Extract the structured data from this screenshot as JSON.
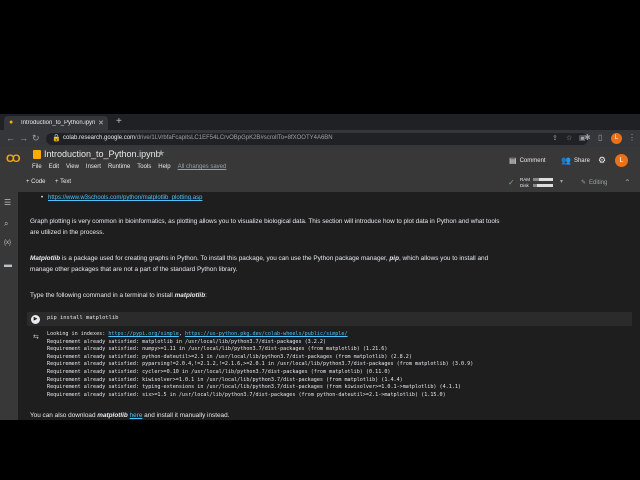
{
  "browser": {
    "tab_title": "Introduction_to_Python.ipynb",
    "new_tab": "+",
    "url_host": "colab.research.google.com",
    "url_path": "/drive/1LVrbfaFcapitsLC1EF54LCrvOBpGpK2B#scrollTo=8fXOOTY4A6BN",
    "profile_initial": "L"
  },
  "colab": {
    "logo": "CO",
    "notebook_title": "Introduction_to_Python.ipynb",
    "menu": [
      "File",
      "Edit",
      "View",
      "Insert",
      "Runtime",
      "Tools",
      "Help"
    ],
    "save_status": "All changes saved",
    "comment_label": "Comment",
    "share_label": "Share",
    "profile_initial": "L"
  },
  "toolbar": {
    "add_code": "+ Code",
    "add_text": "+ Text",
    "ram_label": "RAM",
    "disk_label": "Disk",
    "ram_usage": 0.28,
    "disk_usage": 0.22,
    "mode_label": "Editing"
  },
  "content": {
    "link1": "https://www.w3schools.com/python/matplotlib_plotting.asp",
    "para1": "Graph plotting is very common in bioinformatics, as plotting allows you to visualize biological data. This section will introduce how to plot data in Python and what tools are utilized in the process.",
    "para2_pkg": "Matplotlib",
    "para2_a": " is a package used for creating graphs in Python. To install this package, you can use the Python package manager, ",
    "para2_pip": "pip",
    "para2_b": ", which allows you to install and manage other packages that are not a part of the standard Python library.",
    "para3_a": "Type the following command in a terminal to install ",
    "para3_pkg": "matplotlib",
    "para3_b": ":",
    "code": "pip install matplotlib",
    "output_head": "Looking in indexes: ",
    "output_link1": "https://pypi.org/simple",
    "output_sep": ", ",
    "output_link2": "https://us-python.pkg.dev/colab-wheels/public/simple/",
    "output_lines": [
      "Requirement already satisfied: matplotlib in /usr/local/lib/python3.7/dist-packages (3.2.2)",
      "Requirement already satisfied: numpy>=1.11 in /usr/local/lib/python3.7/dist-packages (from matplotlib) (1.21.6)",
      "Requirement already satisfied: python-dateutil>=2.1 in /usr/local/lib/python3.7/dist-packages (from matplotlib) (2.8.2)",
      "Requirement already satisfied: pyparsing!=2.0.4,!=2.1.2,!=2.1.6,>=2.0.1 in /usr/local/lib/python3.7/dist-packages (from matplotlib) (3.0.9)",
      "Requirement already satisfied: cycler>=0.10 in /usr/local/lib/python3.7/dist-packages (from matplotlib) (0.11.0)",
      "Requirement already satisfied: kiwisolver>=1.0.1 in /usr/local/lib/python3.7/dist-packages (from matplotlib) (1.4.4)",
      "Requirement already satisfied: typing-extensions in /usr/local/lib/python3.7/dist-packages (from kiwisolver>=1.0.1->matplotlib) (4.1.1)",
      "Requirement already satisfied: six>=1.5 in /usr/local/lib/python3.7/dist-packages (from python-dateutil>=2.1->matplotlib) (1.15.0)"
    ],
    "para4_a": "You can also download ",
    "para4_pkg": "matplotlib",
    "para4_space": " ",
    "para4_link": "here",
    "para4_b": " and install it manually instead."
  },
  "colors": {
    "accent": "#f9ab00",
    "link": "#4fc3f7",
    "background": "#1e1e1e"
  }
}
